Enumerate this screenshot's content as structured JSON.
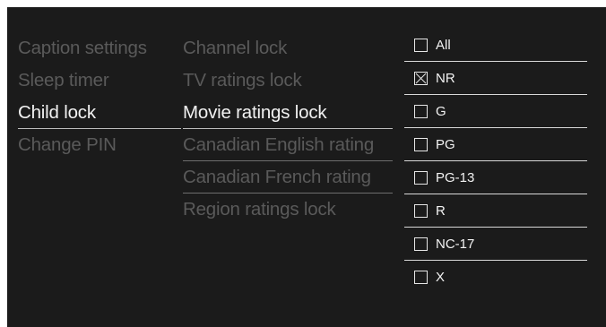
{
  "menu": {
    "items": [
      {
        "label": "Caption settings"
      },
      {
        "label": "Sleep timer"
      },
      {
        "label": "Child lock"
      },
      {
        "label": "Change PIN"
      }
    ]
  },
  "submenu": {
    "items": [
      {
        "label": "Channel lock"
      },
      {
        "label": "TV ratings lock"
      },
      {
        "label": "Movie ratings lock"
      },
      {
        "label": "Canadian English rating"
      },
      {
        "label": "Canadian French rating"
      },
      {
        "label": "Region ratings lock"
      }
    ]
  },
  "ratings": {
    "items": [
      {
        "label": "All",
        "locked": false
      },
      {
        "label": "NR",
        "locked": true
      },
      {
        "label": "G",
        "locked": false
      },
      {
        "label": "PG",
        "locked": false
      },
      {
        "label": "PG-13",
        "locked": false
      },
      {
        "label": "R",
        "locked": false
      },
      {
        "label": "NC-17",
        "locked": false
      },
      {
        "label": "X",
        "locked": false
      }
    ]
  },
  "colors": {
    "background": "#1b1b1b",
    "text_active": "#f2f2f2",
    "text_dim": "#5a5a5a",
    "frame": "#ffffff"
  }
}
